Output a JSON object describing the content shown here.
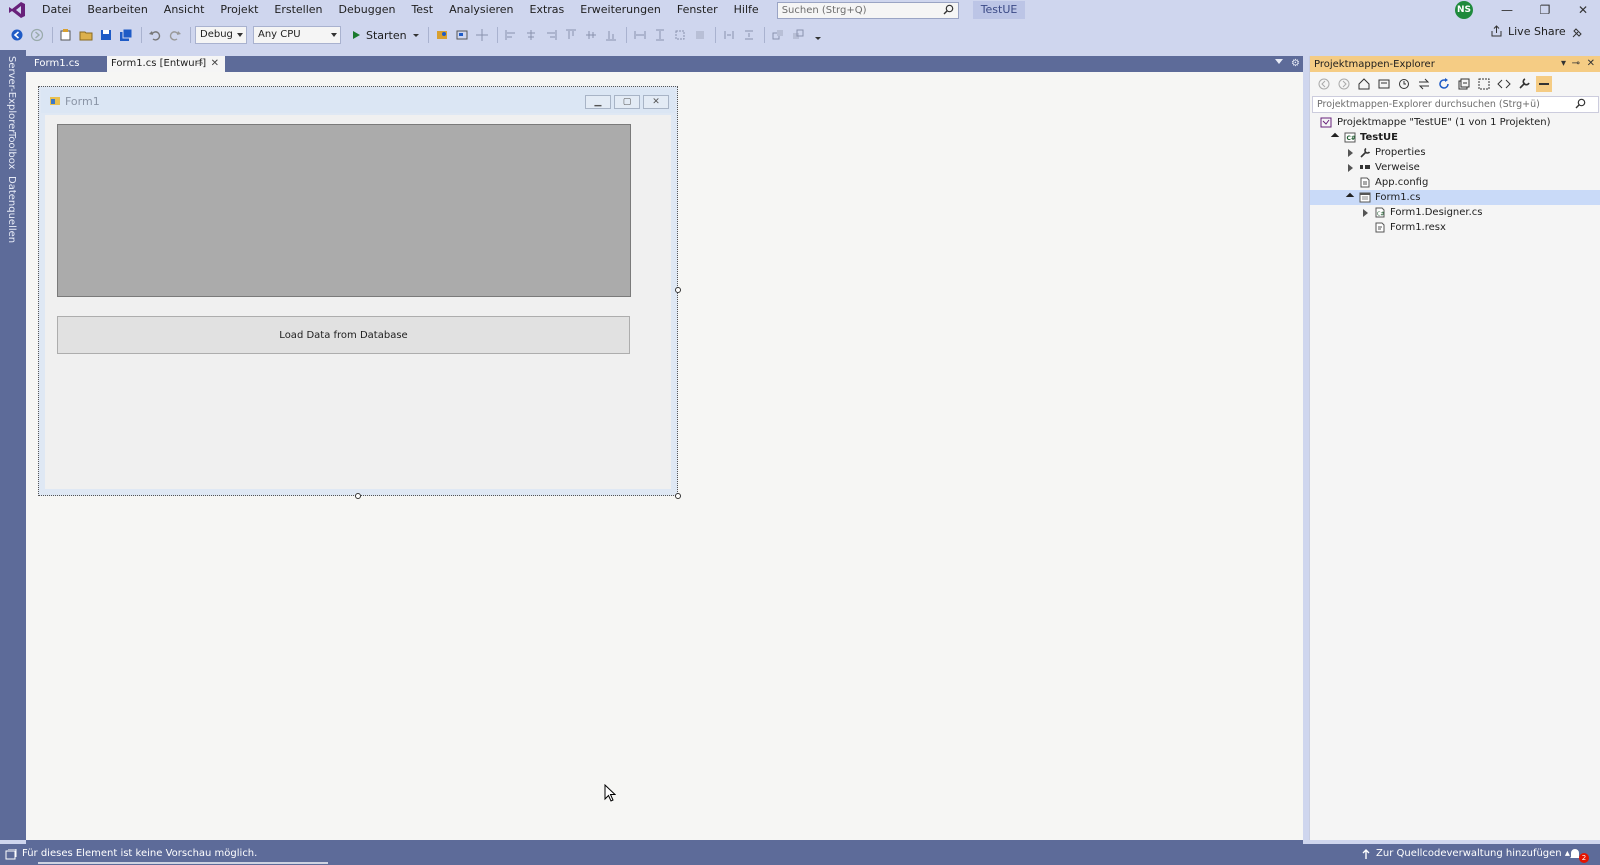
{
  "menu": {
    "items": [
      "Datei",
      "Bearbeiten",
      "Ansicht",
      "Projekt",
      "Erstellen",
      "Debuggen",
      "Test",
      "Analysieren",
      "Extras",
      "Erweiterungen",
      "Fenster",
      "Hilfe"
    ],
    "search_placeholder": "Suchen (Strg+Q)",
    "project_name": "TestUE",
    "avatar_initials": "NS"
  },
  "toolbar": {
    "configuration": "Debug",
    "platform": "Any CPU",
    "start_label": "Starten",
    "live_share_label": "Live Share"
  },
  "left_rail": {
    "tabs": [
      "Server-Explorer",
      "Toolbox",
      "Datenquellen"
    ]
  },
  "document": {
    "tabs": [
      {
        "label": "Form1.cs",
        "active": false
      },
      {
        "label": "Form1.cs [Entwurf]",
        "active": true
      }
    ]
  },
  "form": {
    "title": "Form1",
    "button_label": "Load Data from Database"
  },
  "solution_explorer": {
    "title": "Projektmappen-Explorer",
    "search_placeholder": "Projektmappen-Explorer durchsuchen (Strg+ü)",
    "tree": [
      {
        "label": "Projektmappe \"TestUE\" (1 von 1 Projekten)",
        "level": 0,
        "icon": "solution-icon",
        "expander": "none",
        "bold": false,
        "selected": false
      },
      {
        "label": "TestUE",
        "level": 1,
        "icon": "csharp-project-icon",
        "expander": "expanded",
        "bold": true,
        "selected": false
      },
      {
        "label": "Properties",
        "level": 2,
        "icon": "wrench-icon",
        "expander": "collapsed",
        "bold": false,
        "selected": false
      },
      {
        "label": "Verweise",
        "level": 2,
        "icon": "references-icon",
        "expander": "collapsed",
        "bold": false,
        "selected": false
      },
      {
        "label": "App.config",
        "level": 2,
        "icon": "config-file-icon",
        "expander": "none",
        "bold": false,
        "selected": false
      },
      {
        "label": "Form1.cs",
        "level": 2,
        "icon": "form-icon",
        "expander": "expanded",
        "bold": false,
        "selected": true
      },
      {
        "label": "Form1.Designer.cs",
        "level": 3,
        "icon": "cs-file-icon",
        "expander": "collapsed",
        "bold": false,
        "selected": false
      },
      {
        "label": "Form1.resx",
        "level": 3,
        "icon": "resx-file-icon",
        "expander": "none",
        "bold": false,
        "selected": false
      }
    ]
  },
  "statusbar": {
    "message": "Für dieses Element ist keine Vorschau möglich.",
    "source_control": "Zur Quellcodeverwaltung hinzufügen",
    "notification_count": "2"
  },
  "colors": {
    "chrome": "#cfd6ee",
    "rail": "#5d6b99",
    "accent": "#68217a",
    "se_title": "#f5cc84",
    "selection": "#c9daf8"
  }
}
